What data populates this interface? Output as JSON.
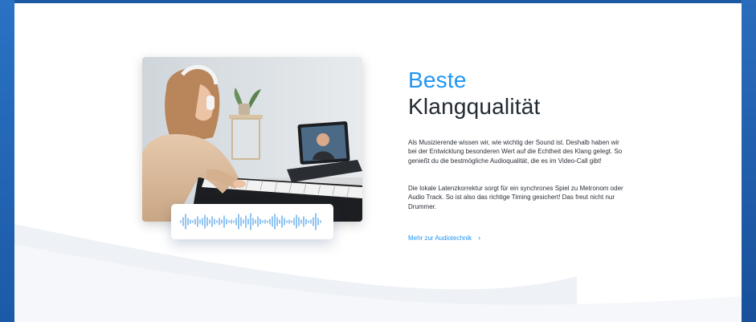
{
  "section": {
    "heading_line1": "Beste",
    "heading_line2": "Klangqualität",
    "paragraph1": "Als Musizierende wissen wir, wie wichtig der Sound ist. Deshalb haben wir bei der Entwicklung besonderen Wert auf die Echtheit des Klang gelegt. So genießt du die bestmögliche Audioqualität, die es im Video-Call gibt!",
    "paragraph2": "Die lokale Latenzkorrektur sorgt für ein synchrones Spiel zu Metronom oder Audio Track. So ist also das richtige Timing gesichert! Das freut nicht nur Drummer.",
    "link_label": "Mehr zur Audiotechnik",
    "link_icon": "chevron-right-icon"
  },
  "colors": {
    "accent": "#2196f3",
    "heading_dark": "#222a33",
    "frame_blue": "#1f5ea8",
    "waveform": "#4a9eea"
  },
  "images": {
    "photo": "girl-with-headphones-playing-keyboard-on-video-call",
    "waveform": "audio-waveform-icon"
  }
}
